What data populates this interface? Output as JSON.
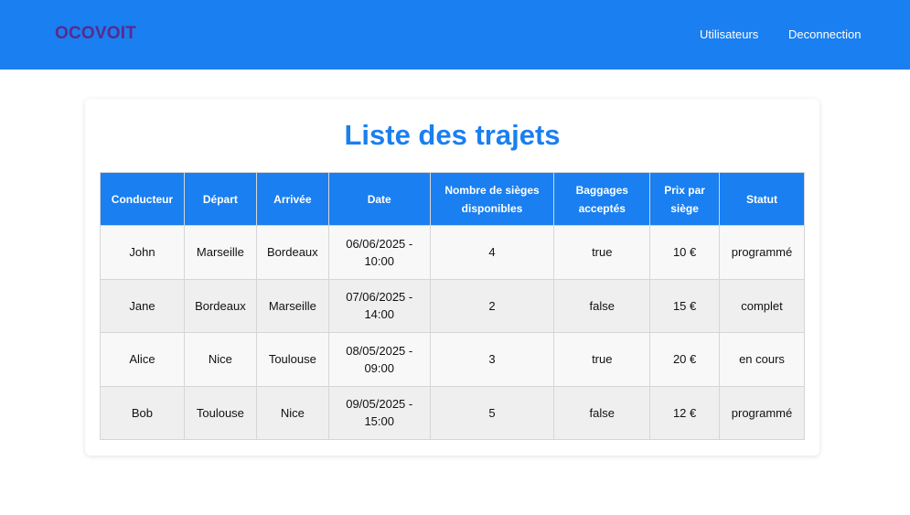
{
  "header": {
    "brand": "OCOVOIT",
    "nav": {
      "users": "Utilisateurs",
      "logout": "Deconnection"
    }
  },
  "main": {
    "title": "Liste des trajets",
    "columns": [
      "Conducteur",
      "Départ",
      "Arrivée",
      "Date",
      "Nombre de sièges disponibles",
      "Baggages acceptés",
      "Prix par siège",
      "Statut"
    ],
    "rows": [
      [
        "John",
        "Marseille",
        "Bordeaux",
        "06/06/2025 - 10:00",
        "4",
        "true",
        "10 €",
        "programmé"
      ],
      [
        "Jane",
        "Bordeaux",
        "Marseille",
        "07/06/2025 - 14:00",
        "2",
        "false",
        "15 €",
        "complet"
      ],
      [
        "Alice",
        "Nice",
        "Toulouse",
        "08/05/2025 - 09:00",
        "3",
        "true",
        "20 €",
        "en cours"
      ],
      [
        "Bob",
        "Toulouse",
        "Nice",
        "09/05/2025 - 15:00",
        "5",
        "false",
        "12 €",
        "programmé"
      ]
    ]
  },
  "colors": {
    "primary": "#1a7ff0",
    "brand": "#5a2a8c"
  }
}
